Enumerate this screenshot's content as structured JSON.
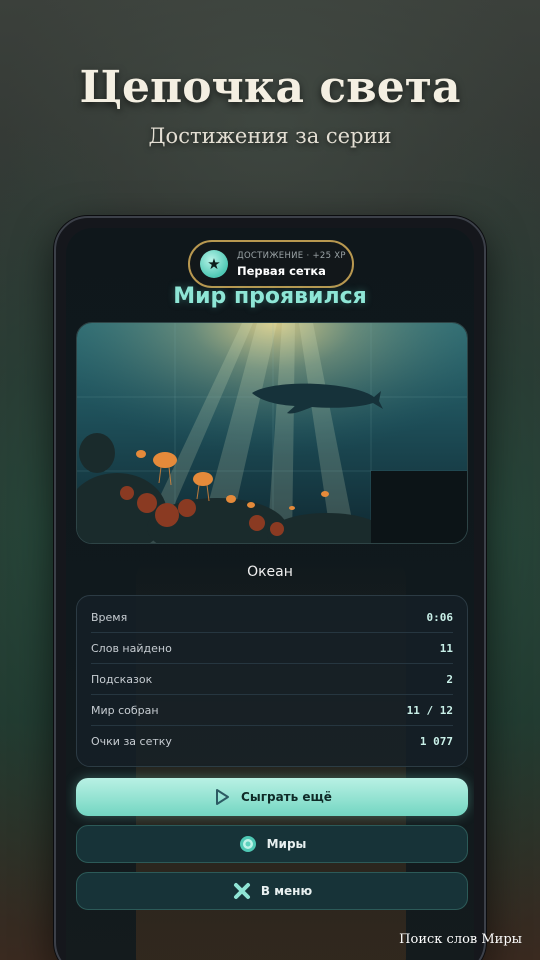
{
  "promo": {
    "title": "Цепочка света",
    "subtitle": "Достижения за серии"
  },
  "achievement": {
    "label": "ДОСТИЖЕНИЕ · +25 XP",
    "name": "Первая сетка",
    "icon": "star-icon"
  },
  "result": {
    "headline": "Мир проявился",
    "image_caption": "Океан"
  },
  "stats": [
    {
      "label": "Время",
      "value": "0:06"
    },
    {
      "label": "Слов найдено",
      "value": "11"
    },
    {
      "label": "Подсказок",
      "value": "2"
    },
    {
      "label": "Мир собран",
      "value": "11 / 12"
    },
    {
      "label": "Очки за сетку",
      "value": "1 077"
    }
  ],
  "buttons": {
    "play_again": "Сыграть ещё",
    "worlds": "Миры",
    "menu": "В меню"
  },
  "watermark": "Поиск слов Миры",
  "colors": {
    "accent": "#8ee6d6",
    "badge_border": "#b89850",
    "primary_button": "#73d6c2"
  }
}
